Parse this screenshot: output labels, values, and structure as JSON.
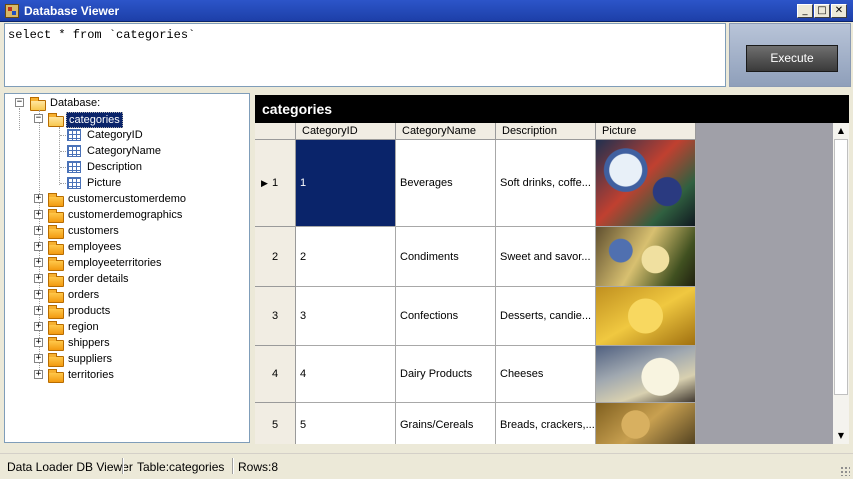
{
  "window": {
    "title": "Database Viewer",
    "minimize": "_",
    "maximize": "□",
    "close": "✕"
  },
  "query": {
    "text": "select * from `categories`",
    "execute_label": "Execute"
  },
  "tree": {
    "root": "Database:",
    "selected_table": "categories",
    "columns": [
      "CategoryID",
      "CategoryName",
      "Description",
      "Picture"
    ],
    "tables": [
      "customercustomerdemo",
      "customerdemographics",
      "customers",
      "employees",
      "employeeterritories",
      "order details",
      "orders",
      "products",
      "region",
      "shippers",
      "suppliers",
      "territories"
    ]
  },
  "grid": {
    "title": "categories",
    "headers": [
      "CategoryID",
      "CategoryName",
      "Description",
      "Picture"
    ],
    "rows": [
      {
        "num": "1",
        "id": "1",
        "name": "Beverages",
        "desc": "Soft drinks, coffe...",
        "img": "beverages-image"
      },
      {
        "num": "2",
        "id": "2",
        "name": "Condiments",
        "desc": "Sweet and savor...",
        "img": "condiments-image"
      },
      {
        "num": "3",
        "id": "3",
        "name": "Confections",
        "desc": "Desserts, candie...",
        "img": "confections-image"
      },
      {
        "num": "4",
        "id": "4",
        "name": "Dairy Products",
        "desc": "Cheeses",
        "img": "dairy-image"
      },
      {
        "num": "5",
        "id": "5",
        "name": "Grains/Cereals",
        "desc": "Breads, crackers,...",
        "img": "grains-image"
      }
    ]
  },
  "status": {
    "app": "Data Loader DB Viewer",
    "table": "Table:categories",
    "rows": "Rows:8"
  },
  "colors": {
    "title_bar": "#1d3fa8",
    "selection": "#0a246a",
    "grid_header": "#000000"
  }
}
